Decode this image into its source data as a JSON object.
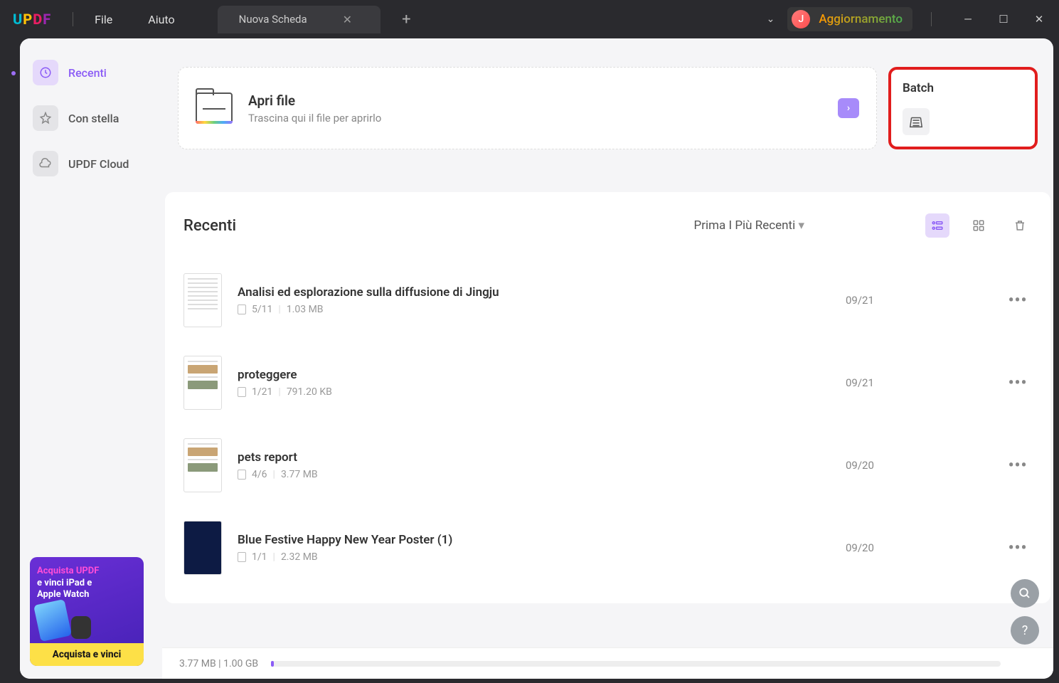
{
  "logo": {
    "u": "U",
    "p": "P",
    "d": "D",
    "f": "F"
  },
  "menu": {
    "file": "File",
    "help": "Aiuto"
  },
  "tab": {
    "title": "Nuova Scheda"
  },
  "user": {
    "initial": "J",
    "update": "Aggiornamento"
  },
  "sidebar": {
    "recent": "Recenti",
    "starred": "Con stella",
    "cloud": "UPDF Cloud"
  },
  "promo": {
    "line1": "Acquista UPDF",
    "line2": "e vinci iPad e",
    "line3": "Apple Watch",
    "cta": "Acquista e vinci"
  },
  "open": {
    "title": "Apri file",
    "subtitle": "Trascina qui il file per aprirlo"
  },
  "batch": {
    "title": "Batch"
  },
  "recent_section": {
    "title": "Recenti",
    "sort": "Prima I Più Recenti"
  },
  "files": [
    {
      "name": "Analisi ed esplorazione sulla diffusione di Jingju",
      "pages": "5/11",
      "size": "1.03 MB",
      "date": "09/21",
      "thumb": "lines"
    },
    {
      "name": "proteggere",
      "pages": "1/21",
      "size": "791.20 KB",
      "date": "09/21",
      "thumb": "blocks"
    },
    {
      "name": "pets report",
      "pages": "4/6",
      "size": "3.77 MB",
      "date": "09/20",
      "thumb": "blocks"
    },
    {
      "name": "Blue Festive Happy New Year Poster (1)",
      "pages": "1/1",
      "size": "2.32 MB",
      "date": "09/20",
      "thumb": "dark"
    }
  ],
  "footer": {
    "storage": "3.77 MB | 1.00 GB"
  }
}
